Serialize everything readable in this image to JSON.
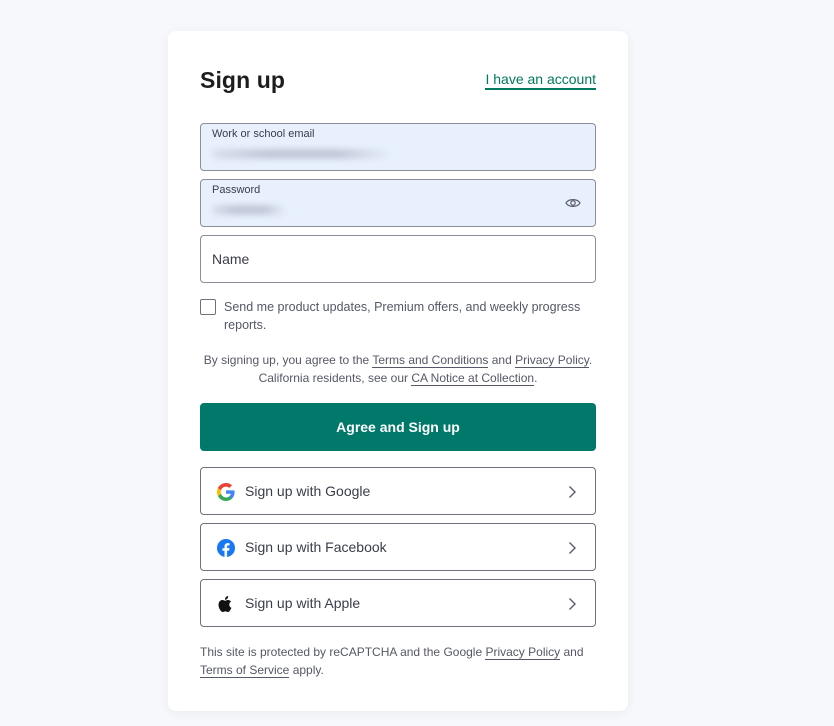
{
  "header": {
    "title": "Sign up",
    "account_link": "I have an account"
  },
  "form": {
    "email_label": "Work or school email",
    "password_label": "Password",
    "name_placeholder": "Name"
  },
  "newsletter": {
    "label": "Send me product updates, Premium offers, and weekly progress reports.",
    "checked": false
  },
  "legal": {
    "prefix": "By signing up, you agree to the ",
    "terms_link": "Terms and Conditions",
    "and": " and ",
    "privacy_link": "Privacy Policy",
    "suffix": ".",
    "california_prefix": "California residents, see our ",
    "ca_notice_link": "CA Notice at Collection",
    "california_suffix": "."
  },
  "primary_button": "Agree and Sign up",
  "social": [
    {
      "label": "Sign up with Google",
      "icon": "google-icon"
    },
    {
      "label": "Sign up with Facebook",
      "icon": "facebook-icon"
    },
    {
      "label": "Sign up with Apple",
      "icon": "apple-icon"
    }
  ],
  "footer": {
    "prefix": "This site is protected by reCAPTCHA and the Google ",
    "privacy_link": "Privacy Policy",
    "and": " and ",
    "terms_link": "Terms of Service",
    "suffix": " apply."
  },
  "colors": {
    "accent": "#00795f",
    "primary_button": "#00796b",
    "filled_field": "#e8f0fd",
    "facebook": "#1877f2"
  }
}
